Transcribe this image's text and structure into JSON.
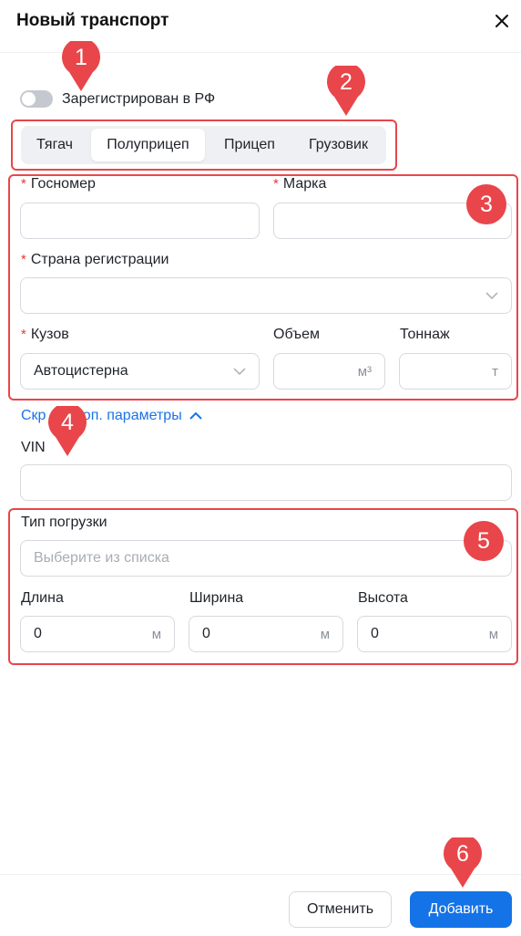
{
  "dialog": {
    "title": "Новый транспорт"
  },
  "registration": {
    "label": "Зарегистрирован в РФ",
    "enabled": false
  },
  "tabs": [
    {
      "label": "Тягач",
      "active": false
    },
    {
      "label": "Полуприцеп",
      "active": true
    },
    {
      "label": "Прицеп",
      "active": false
    },
    {
      "label": "Грузовик",
      "active": false
    }
  ],
  "form": {
    "required_mark": "*",
    "plate": {
      "label": "Госномер",
      "value": ""
    },
    "brand": {
      "label": "Марка",
      "value": ""
    },
    "country": {
      "label": "Страна регистрации",
      "value": ""
    },
    "body": {
      "label": "Кузов",
      "value": "Автоцистерна"
    },
    "volume": {
      "label": "Объем",
      "value": "",
      "unit": "м³"
    },
    "tonnage": {
      "label": "Тоннаж",
      "value": "",
      "unit": "т"
    },
    "toggle_link": "Скрыть доп. параметры",
    "toggle_link_prefix": "Скр",
    "toggle_link_suffix": "доп. параметры",
    "vin": {
      "label": "VIN",
      "value": ""
    },
    "loading_type": {
      "label": "Тип погрузки",
      "placeholder": "Выберите из списка"
    },
    "length": {
      "label": "Длина",
      "value": "0",
      "unit": "м"
    },
    "width": {
      "label": "Ширина",
      "value": "0",
      "unit": "м"
    },
    "height": {
      "label": "Высота",
      "value": "0",
      "unit": "м"
    }
  },
  "annotations": {
    "m1": "1",
    "m2": "2",
    "m3": "3",
    "m4": "4",
    "m5": "5",
    "m6": "6"
  },
  "footer": {
    "cancel": "Отменить",
    "add": "Добавить"
  },
  "colors": {
    "accent": "#1473e6",
    "annotation": "#e8464a",
    "required": "#e23b3b"
  }
}
